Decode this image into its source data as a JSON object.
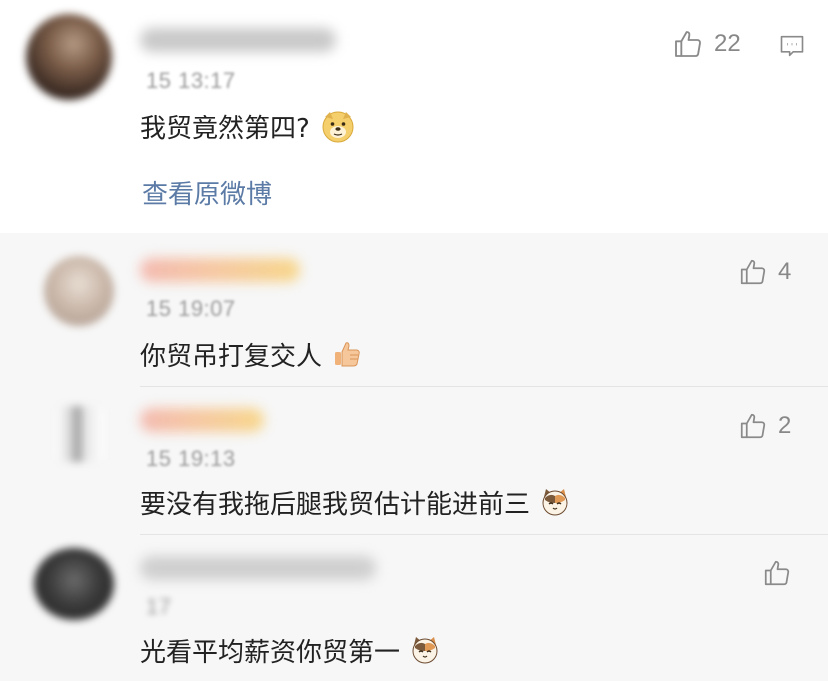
{
  "main_comment": {
    "time": "15 13:17",
    "text": "我贸竟然第四?",
    "emoji": "doge-emoji",
    "likes": "22",
    "view_original": "查看原微博"
  },
  "replies": [
    {
      "time": "15 19:07",
      "text": "你贸吊打复交人",
      "emoji": "thumbs-up-emoji",
      "likes": "4"
    },
    {
      "time": "15 19:13",
      "text": "要没有我拖后腿我贸估计能进前三",
      "emoji": "cat-emoji",
      "likes": "2"
    },
    {
      "time": "17",
      "text": "光看平均薪资你贸第一",
      "emoji": "cat-emoji",
      "likes": ""
    }
  ],
  "colors": {
    "link": "#5b7ba6",
    "meta": "#9a9a9a",
    "icon": "#8a8a8a",
    "reply_bg": "#f7f7f7"
  }
}
